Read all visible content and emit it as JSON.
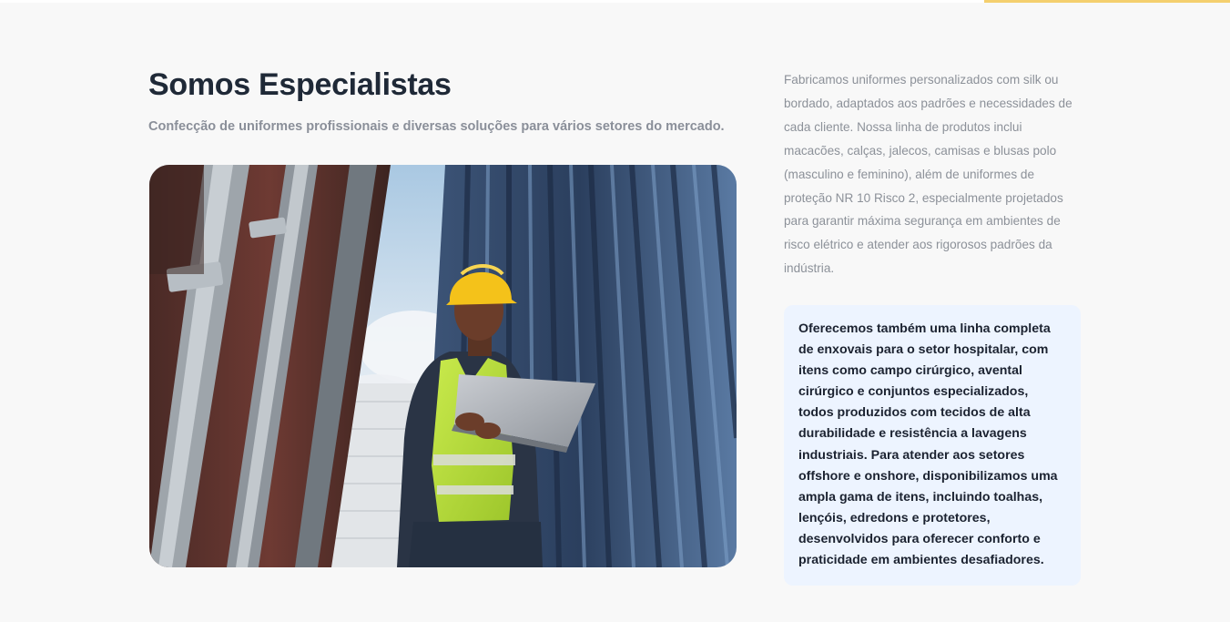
{
  "section": {
    "title": "Somos Especialistas",
    "subtitle": "Confecção de uniformes profissionais e diversas soluções para vários setores do mercado.",
    "intro": "Fabricamos uniformes personalizados com silk ou bordado, adaptados aos padrões e necessidades de cada cliente. Nossa linha de produtos inclui macacões, calças, jalecos, camisas e blusas polo (masculino e feminino), além de uniformes de proteção NR 10 Risco 2, especialmente projetados para garantir máxima segurança em ambientes de risco elétrico e atender aos rigorosos padrões da indústria.",
    "highlight": "Oferecemos também uma linha completa de enxovais para o setor hospitalar, com itens como campo cirúrgico, avental cirúrgico e conjuntos especializados, todos produzidos com tecidos de alta durabilidade e resistência a lavagens industriais. Para atender aos setores offshore e onshore, disponibilizamos uma ampla gama de itens, incluindo toalhas, lençóis, edredons e protetores, desenvolvidos para oferecer conforto e praticidade em ambientes desafiadores."
  },
  "colors": {
    "background": "#f8f8f8",
    "accent": "#f4cf6e",
    "highlight_bg": "#edf4ff",
    "title": "#1f2937",
    "muted_text": "#8c9199"
  }
}
